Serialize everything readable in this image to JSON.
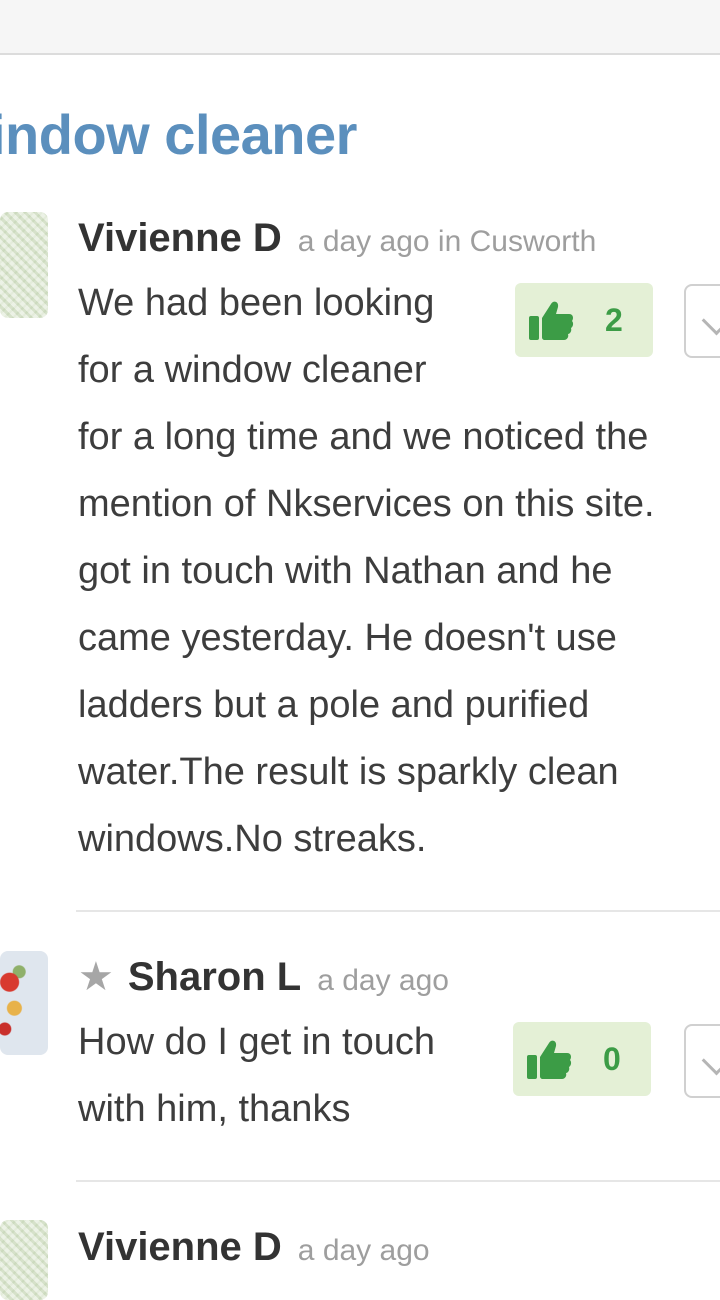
{
  "page": {
    "title": "indow cleaner"
  },
  "comments": [
    {
      "author": "Vivienne D",
      "meta": "a day ago in Cusworth",
      "lines": [
        "We had been looking",
        "for a window cleaner",
        "for a long time and we noticed the",
        "mention of Nkservices on this site.",
        "got in touch with Nathan and he",
        "came yesterday. He doesn't use",
        "ladders but a pole and purified",
        "water.The result is sparkly clean",
        "windows.No streaks."
      ],
      "likes": "2"
    },
    {
      "author": "Sharon L",
      "meta": "a day ago",
      "lines": [
        "How do I get in touch",
        "with him, thanks"
      ],
      "likes": "0"
    },
    {
      "author": "Vivienne D",
      "meta": "a day ago"
    }
  ],
  "colors": {
    "title": "#5b8fbd",
    "like_bg": "#e4f0d6",
    "like_fg": "#3c9c46",
    "meta": "#9e9e9e"
  },
  "icons": {
    "like": "thumbs-up-icon",
    "favorite": "star-icon",
    "more": "chevron-down-icon"
  }
}
